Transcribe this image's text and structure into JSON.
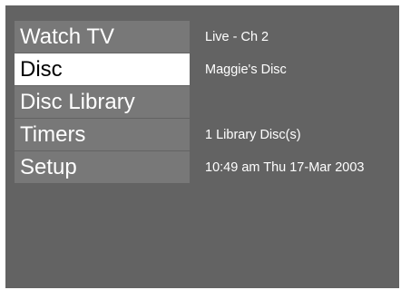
{
  "menu": {
    "items": [
      {
        "label": "Watch TV"
      },
      {
        "label": "Disc"
      },
      {
        "label": "Disc Library"
      },
      {
        "label": "Timers"
      },
      {
        "label": "Setup"
      }
    ],
    "selected_index": 1
  },
  "info": {
    "channel": "Live - Ch 2",
    "disc_name": "Maggie's Disc",
    "library_count": "1 Library Disc(s)",
    "datetime": "10:49 am Thu 17-Mar 2003"
  },
  "colors": {
    "background": "#636363",
    "menu_item": "#787878",
    "menu_selected": "#ffffff",
    "text": "#ffffff",
    "selected_text": "#000000"
  }
}
